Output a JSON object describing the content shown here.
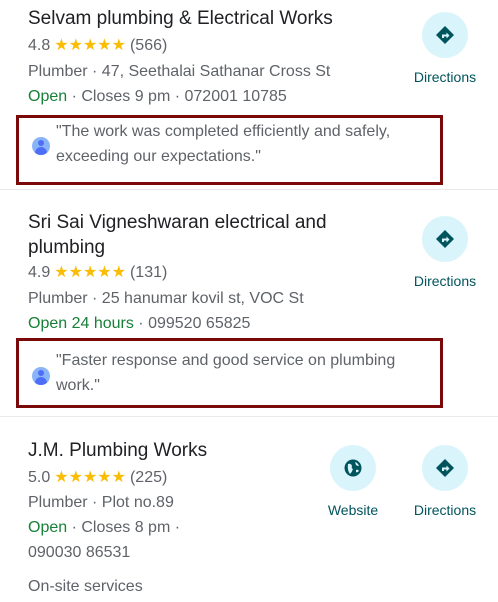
{
  "listings": [
    {
      "name": "Selvam plumbing & Electrical Works",
      "rating": "4.8",
      "stars": "★★★★★",
      "reviews": "(566)",
      "category_address": "Plumber · 47, Seethalai Sathanar Cross St",
      "status": "Open",
      "hours_phone": " · Closes 9 pm · 072001 10785",
      "review": "\"The work was completed efficiently and safely, exceeding our expectations.\"",
      "directions_label": "Directions"
    },
    {
      "name": "Sri Sai Vigneshwaran electrical and plumbing",
      "rating": "4.9",
      "stars": "★★★★★",
      "reviews": "(131)",
      "category_address": "Plumber · 25 hanumar kovil st, VOC St",
      "status": "Open 24 hours",
      "hours_phone": " · 099520 65825",
      "review": "\"Faster response and good service on plumbing work.\"",
      "directions_label": "Directions"
    },
    {
      "name": "J.M. Plumbing Works",
      "rating": "5.0",
      "stars": "★★★★★",
      "reviews": "(225)",
      "category_address": "Plumber · Plot no.89",
      "status": "Open",
      "hours_phone": " · Closes 8 pm ·",
      "phone": "090030 86531",
      "service": "On-site services",
      "website_label": "Website",
      "directions_label": "Directions"
    }
  ],
  "icons": {
    "directions": "directions-icon",
    "website": "globe-icon",
    "avatar": "user-avatar-icon"
  },
  "colors": {
    "star": "#fbbc04",
    "open": "#188038",
    "action_bg": "#d9f5fb",
    "action_icon": "#00545c",
    "highlight_border": "#7a0a0a"
  }
}
